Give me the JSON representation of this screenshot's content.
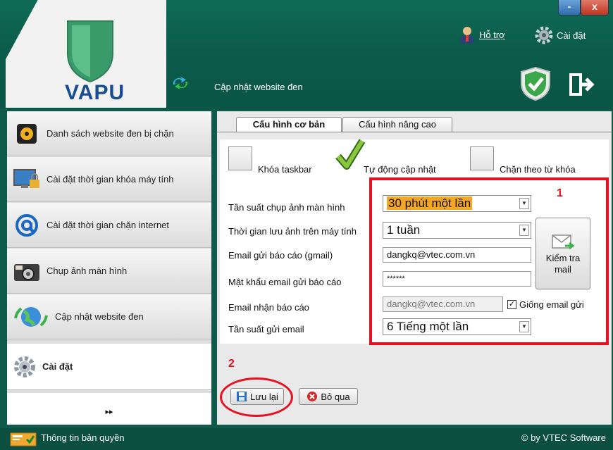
{
  "header": {
    "brand": "VAPU",
    "support_label": "Hỗ trợ",
    "settings_label": "Cài đặt",
    "update_label": "Cập nhật website đen",
    "minimize": "-",
    "close": "x"
  },
  "sidebar": {
    "items": [
      {
        "label": "Danh sách website đen bị chặn",
        "icon": "blocked-sites-icon"
      },
      {
        "label": "Cài đặt thời gian khóa máy tính",
        "icon": "lock-computer-icon"
      },
      {
        "label": "Cài đặt thời gian chặn internet",
        "icon": "at-sign-icon"
      },
      {
        "label": "Chụp ảnh màn hình",
        "icon": "camera-icon"
      },
      {
        "label": "Cập nhật website đen",
        "icon": "globe-update-icon"
      },
      {
        "label": "Cài đặt",
        "icon": "gear-icon"
      }
    ],
    "more": "▸▸"
  },
  "tabs": {
    "basic": "Cấu hình cơ bản",
    "advanced": "Cấu hình nâng cao"
  },
  "options": {
    "lock_taskbar": "Khóa taskbar",
    "lock_taskbar_checked": false,
    "auto_update": "Tự động cập nhật",
    "auto_update_checked": true,
    "keyword_block": "Chặn theo từ khóa",
    "keyword_block_checked": false
  },
  "form": {
    "capture_freq_label": "Tần suất chụp ảnh màn hình",
    "capture_freq_value": "30 phút một lần",
    "retention_label": "Thời gian lưu ảnh trên máy tính",
    "retention_value": "1 tuần",
    "sender_email_label": "Email gửi báo cáo (gmail)",
    "sender_email_value": "dangkq@vtec.com.vn",
    "sender_password_label": "Mật khẩu email gửi báo cáo",
    "sender_password_value": "******",
    "receiver_email_label": "Email nhận báo cáo",
    "receiver_email_value": "dangkq@vtec.com.vn",
    "same_email_label": "Giống email gửi",
    "same_email_checked": true,
    "send_freq_label": "Tần suất gửi email",
    "send_freq_value": "6 Tiếng một lần",
    "check_mail_line1": "Kiểm tra",
    "check_mail_line2": "mail"
  },
  "annotations": {
    "one": "1",
    "two": "2"
  },
  "actions": {
    "save": "Lưu lại",
    "cancel": "Bỏ qua"
  },
  "footer": {
    "license": "Thông tin bản quyền",
    "copyright": "© by VTEC Software"
  },
  "colors": {
    "header_bg": "#0c5d4c",
    "highlight": "#f5a623",
    "annotation_red": "#e8101f"
  }
}
